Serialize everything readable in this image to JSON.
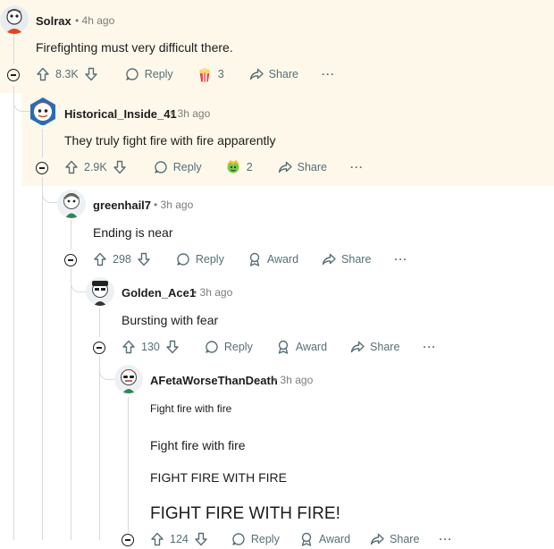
{
  "comments": [
    {
      "author": "Solrax",
      "time": "4h ago",
      "body": "Firefighting must very difficult there.",
      "votes": "8.3K",
      "reply": "Reply",
      "award_count": "3",
      "share": "Share",
      "more": "···"
    },
    {
      "author": "Historical_Inside_41",
      "time": "3h ago",
      "body": "They truly fight fire with fire apparently",
      "votes": "2.9K",
      "reply": "Reply",
      "award_count": "2",
      "share": "Share",
      "more": "···"
    },
    {
      "author": "greenhail7",
      "time": "3h ago",
      "body": "Ending is near",
      "votes": "298",
      "reply": "Reply",
      "award": "Award",
      "share": "Share",
      "more": "···"
    },
    {
      "author": "Golden_Ace1",
      "time": "3h ago",
      "body": "Bursting with fear",
      "votes": "130",
      "reply": "Reply",
      "award": "Award",
      "share": "Share",
      "more": "···"
    },
    {
      "author": "AFetaWorseThanDeath",
      "time": "3h ago",
      "lines": [
        "Fight fire with fire",
        "Fight fire with fire",
        "FIGHT FIRE WITH FIRE",
        "FIGHT FIRE WITH FIRE!"
      ],
      "votes": "124",
      "reply": "Reply",
      "award": "Award",
      "share": "Share",
      "more": "···"
    }
  ],
  "separator": "•",
  "icons": {
    "upvote": "arrow-up-icon",
    "downvote": "arrow-down-icon",
    "reply": "speech-bubble-icon",
    "award": "award-ribbon-icon",
    "share": "share-arrow-icon",
    "collapse": "collapse-minus-icon"
  },
  "colors": {
    "highlight": "#fdf8ea",
    "meta": "#7c7c7c",
    "action": "#576f76",
    "line": "#d7dadc"
  }
}
